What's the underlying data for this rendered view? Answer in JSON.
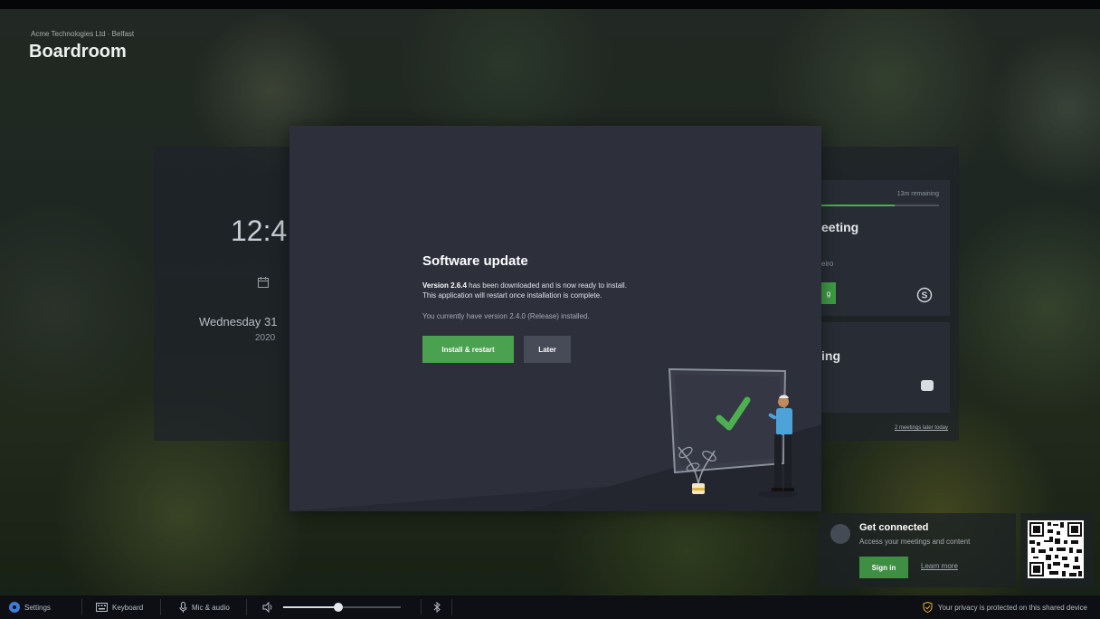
{
  "room": {
    "subtitle": "Acme Technologies Ltd · Belfast",
    "title": "Boardroom"
  },
  "clock": {
    "time": "12:4",
    "date": "Wednesday 31",
    "year": "2020"
  },
  "meetings": {
    "remaining": "13m remaining",
    "remaining_fraction": 0.62,
    "current_title": "eeting",
    "current_organizer": "eiro",
    "join_label": "g",
    "next_title": "ing",
    "more_link": "2 meetings later today"
  },
  "dialog": {
    "title": "Software update",
    "version_bold": "Version 2.6.4",
    "line1_rest": " has been downloaded and is now ready to install.",
    "line2": "This application will restart once installation is complete.",
    "line3": "You currently have version 2.4.0 (Release) installed.",
    "install_label": "Install & restart",
    "later_label": "Later"
  },
  "get_connected": {
    "title": "Get connected",
    "subtitle": "Access your meetings and content",
    "signin_label": "Sign in",
    "learn_label": "Learn more"
  },
  "taskbar": {
    "settings": "Settings",
    "keyboard": "Keyboard",
    "mic": "Mic & audio",
    "volume_fraction": 0.46,
    "privacy": "Your privacy is protected on this shared device"
  },
  "colors": {
    "accent_green": "#4aa150",
    "dialog_bg": "#2d2f3b",
    "taskbar_bg": "#0d0f14",
    "settings_icon": "#3b7dd8",
    "privacy_icon": "#e3b341"
  },
  "icons": [
    "calendar-icon",
    "skype-icon",
    "video-camera-icon",
    "settings-icon",
    "keyboard-icon",
    "microphone-icon",
    "speaker-icon",
    "bluetooth-icon",
    "shield-check-icon",
    "person-icon",
    "qr-code"
  ]
}
